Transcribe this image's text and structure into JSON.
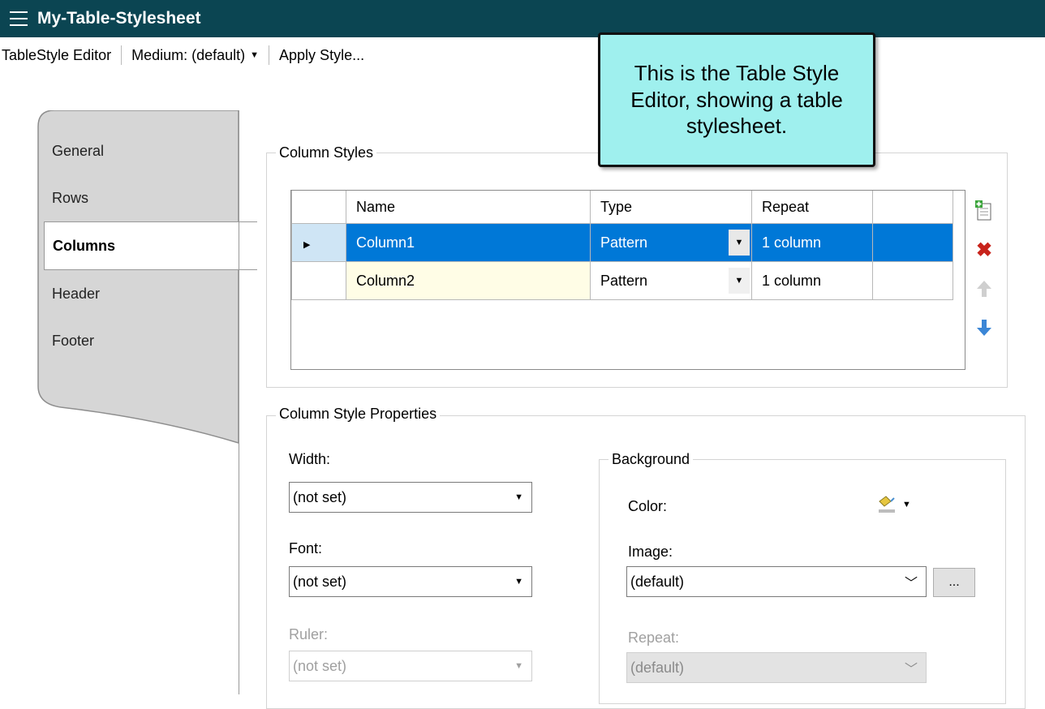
{
  "window": {
    "title": "My-Table-Stylesheet"
  },
  "toolbar": {
    "editor_label": "TableStyle Editor",
    "medium_label": "Medium: (default)",
    "apply_label": "Apply Style..."
  },
  "tabs": [
    {
      "label": "General"
    },
    {
      "label": "Rows"
    },
    {
      "label": "Columns",
      "active": true
    },
    {
      "label": "Header"
    },
    {
      "label": "Footer"
    }
  ],
  "column_styles": {
    "group_label": "Column Styles",
    "headers": [
      "Name",
      "Type",
      "Repeat"
    ],
    "rows": [
      {
        "name": "Column1",
        "type": "Pattern",
        "repeat": "1 column",
        "selected": true
      },
      {
        "name": "Column2",
        "type": "Pattern",
        "repeat": "1 column",
        "selected": false
      }
    ],
    "icons": [
      "add-icon",
      "delete-icon",
      "move-up-icon",
      "move-down-icon"
    ]
  },
  "properties": {
    "group_label": "Column Style Properties",
    "width_label": "Width:",
    "width_value": "(not set)",
    "font_label": "Font:",
    "font_value": "(not set)",
    "ruler_label": "Ruler:",
    "ruler_value": "(not set)",
    "background": {
      "group_label": "Background",
      "color_label": "Color:",
      "image_label": "Image:",
      "image_value": "(default)",
      "browse_label": "...",
      "repeat_label": "Repeat:",
      "repeat_value": "(default)"
    }
  },
  "callout": {
    "text": "This is the Table Style Editor, showing a table stylesheet."
  },
  "colors": {
    "titlebar": "#0b4552",
    "selection": "#0078d7",
    "callout": "#9ff0ee"
  }
}
